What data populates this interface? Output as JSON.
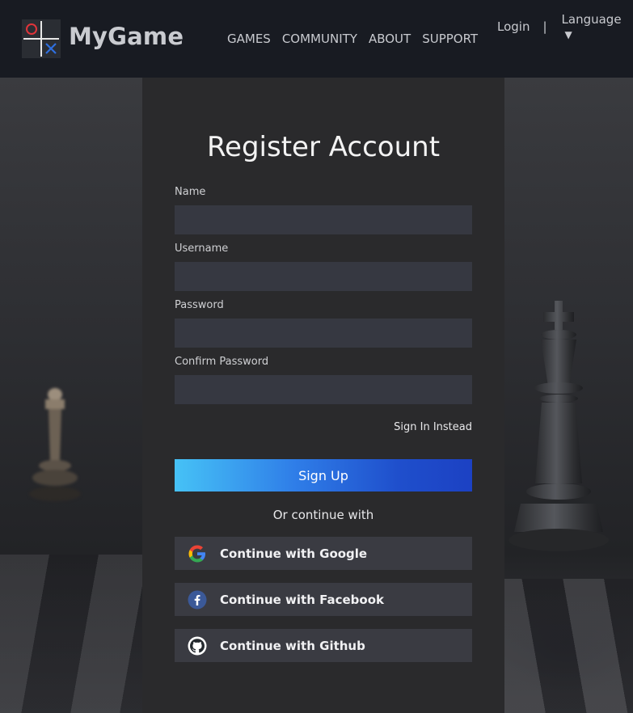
{
  "header": {
    "brand": "MyGame",
    "nav": [
      "GAMES",
      "COMMUNITY",
      "ABOUT",
      "SUPPORT"
    ],
    "login": "Login",
    "separator": "|",
    "language": "Language",
    "language_caret": "▼"
  },
  "form": {
    "title": "Register Account",
    "fields": [
      {
        "label": "Name",
        "value": "",
        "placeholder": ""
      },
      {
        "label": "Username",
        "value": "",
        "placeholder": ""
      },
      {
        "label": "Password",
        "value": "",
        "placeholder": ""
      },
      {
        "label": "Confirm Password",
        "value": "",
        "placeholder": ""
      }
    ],
    "sign_in_link": "Sign In Instead",
    "submit_label": "Sign Up",
    "or_text": "Or continue with",
    "social": [
      {
        "label": "Continue with Google",
        "icon": "google-icon"
      },
      {
        "label": "Continue with Facebook",
        "icon": "facebook-icon"
      },
      {
        "label": "Continue with Github",
        "icon": "github-icon"
      }
    ]
  },
  "colors": {
    "header_bg": "#181b22",
    "panel_bg": "#2a2a2c",
    "input_bg": "#363841",
    "button_gradient_start": "#46c2f6",
    "button_gradient_end": "#1c41c3",
    "social_bg": "#3a3b42",
    "logo_o": "#e0343a",
    "logo_x": "#2f6fe0"
  }
}
